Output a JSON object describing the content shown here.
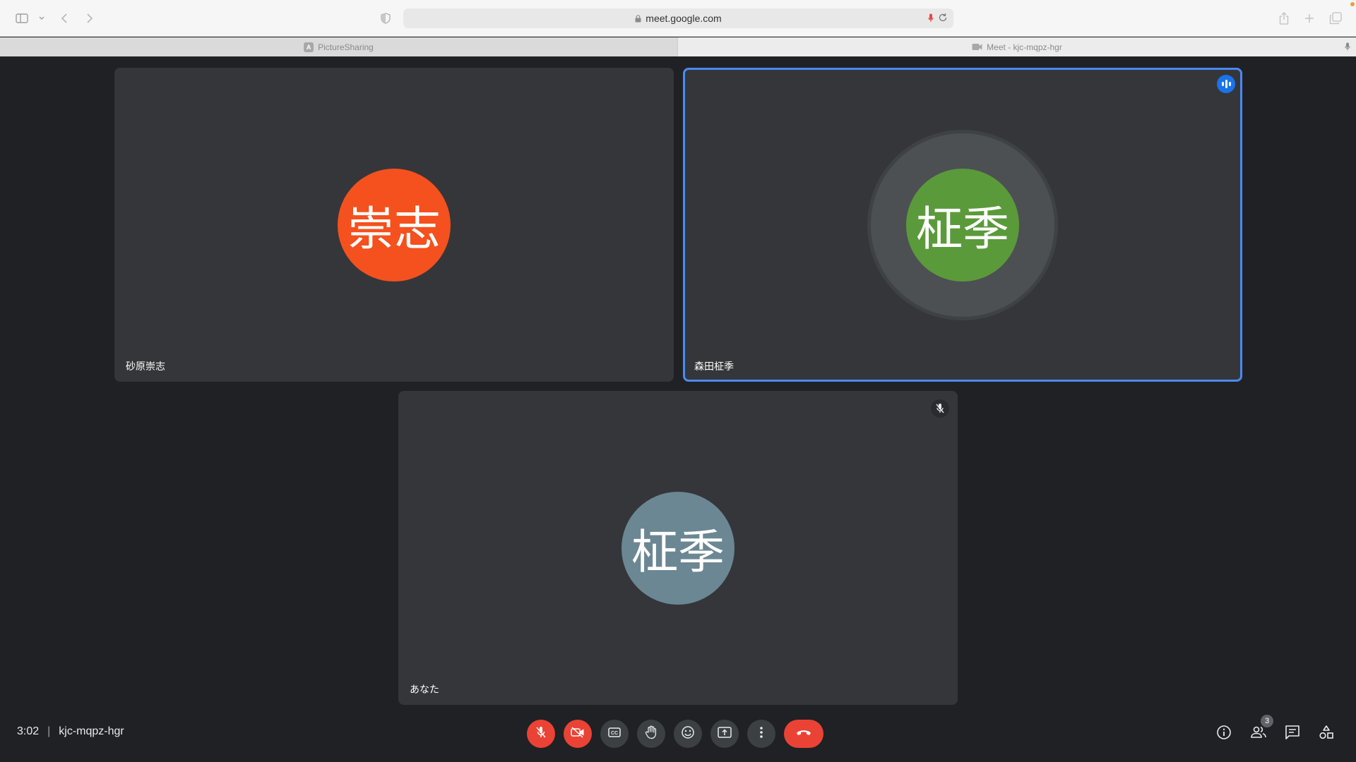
{
  "browser": {
    "url": "meet.google.com",
    "tabs": [
      {
        "label": "PictureSharing",
        "favicon": "A"
      },
      {
        "label": "Meet - kjc-mqpz-hgr"
      }
    ]
  },
  "participants": [
    {
      "name": "砂原崇志",
      "initials": "崇志",
      "color": "#f4511e",
      "speaking": false,
      "muted": false
    },
    {
      "name": "森田柾季",
      "initials": "柾季",
      "color": "#5b9a3b",
      "speaking": true,
      "muted": false
    },
    {
      "name": "あなた",
      "initials": "柾季",
      "color": "#6b8793",
      "speaking": false,
      "muted": true
    }
  ],
  "meeting": {
    "time": "3:02",
    "code": "kjc-mqpz-hgr",
    "participant_count": "3"
  },
  "colors": {
    "accent": "#1a73e8",
    "danger": "#ea4335",
    "tile_bg": "#35363a",
    "stage_bg": "#202124"
  }
}
